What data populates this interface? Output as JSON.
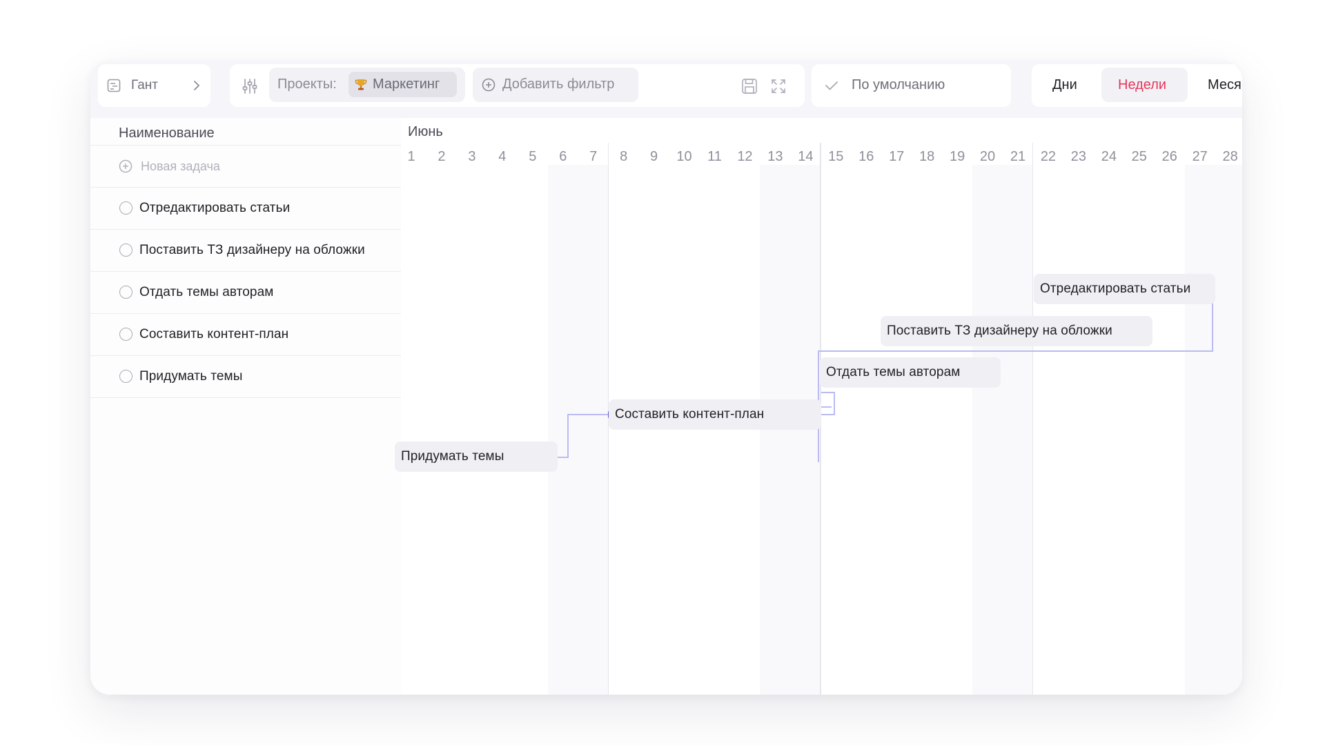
{
  "toolbar": {
    "view_label": "Гант",
    "projects_label": "Проекты:",
    "project_name": "Маркетинг",
    "add_filter_label": "Добавить фильтр",
    "sort_label": "По умолчанию",
    "scale": {
      "days": "Дни",
      "weeks": "Недели",
      "months": "Меся",
      "active": "weeks"
    }
  },
  "list": {
    "header": "Наименование",
    "new_task_label": "Новая задача",
    "tasks": [
      {
        "label": "Отредактировать статьи"
      },
      {
        "label": "Поставить ТЗ дизайнеру на обложки"
      },
      {
        "label": "Отдать темы авторам"
      },
      {
        "label": "Составить контент-план"
      },
      {
        "label": "Придумать темы"
      }
    ]
  },
  "timeline": {
    "month": "Июнь",
    "days": [
      "1",
      "2",
      "3",
      "4",
      "5",
      "6",
      "7",
      "8",
      "9",
      "10",
      "11",
      "12",
      "13",
      "14",
      "15",
      "16",
      "17",
      "18",
      "19",
      "20",
      "21",
      "22",
      "23",
      "24",
      "25",
      "26",
      "27",
      "28"
    ],
    "bars": [
      {
        "label": "Отредактировать статьи"
      },
      {
        "label": "Поставить ТЗ дизайнеру на обложки"
      },
      {
        "label": "Отдать темы авторам"
      },
      {
        "label": "Составить контент-план"
      },
      {
        "label": "Придумать темы"
      }
    ]
  },
  "colors": {
    "accent": "#e6355a",
    "link_line": "#b9bbf2",
    "link_arrow": "#5b5fe0",
    "bar": "#f0f0f4"
  }
}
